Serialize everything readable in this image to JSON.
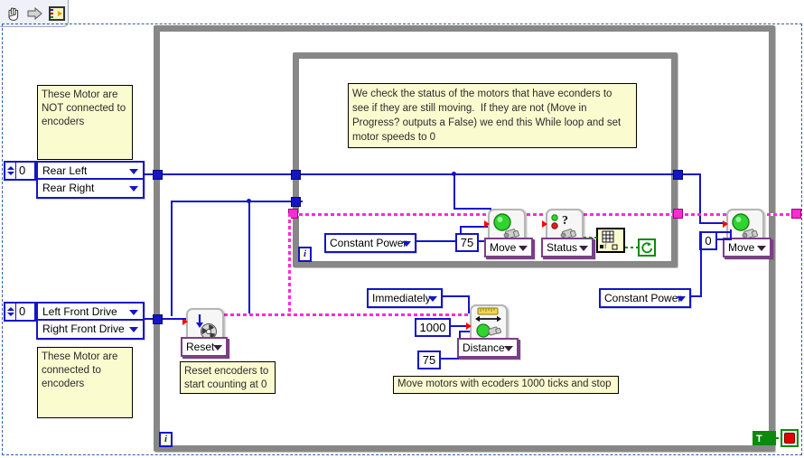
{
  "toolbar": {
    "icons": [
      {
        "name": "hand-tool-icon",
        "label": "Operate Value"
      },
      {
        "name": "arrow-tool-icon",
        "label": "Position/Size/Select"
      },
      {
        "name": "connector-pane-icon",
        "label": "Connector Pane"
      }
    ]
  },
  "comments": {
    "top_left": "These Motor are\nNOT connected to\nencoders",
    "status_note": "We check the status of the motors that have econders to\nsee if they are still moving.  If they are not (Move in\nProgress? outputs a False) we end this While loop and set\nmotor speeds to 0",
    "bottom_left": "These Motor are\nconnected to\nencoders",
    "reset_note": "Reset encoders to\nstart counting at 0",
    "encoder_move_note": "Move motors with ecoders 1000 ticks and stop"
  },
  "controls": {
    "rear_numeric": "0",
    "front_numeric": "0",
    "rear_motors": [
      "Rear Left",
      "Rear Right"
    ],
    "front_motors": [
      "Left Front Drive",
      "Right Front Drive"
    ]
  },
  "nodes": {
    "constant_power_inner": "Constant Power",
    "constant_power_outer": "Constant Power",
    "move_inner_selector": "Move",
    "move_inner_speed": "75",
    "status_selector": "Status",
    "move_outer_selector": "Move",
    "move_outer_speed": "0",
    "reset_selector": "Reset",
    "distance_selector": "Distance",
    "distance_mode": "Immediately",
    "distance_ticks": "1000",
    "distance_power": "75"
  },
  "loops": {
    "outer_iteration_label": "i",
    "inner_iteration_label": "i"
  },
  "terminals": {
    "true_constant": "T",
    "stop_button": "stop-button"
  },
  "colors": {
    "wire_numeric": "#1414c8",
    "wire_cluster": "#ff2ad4",
    "wire_boolean": "#0b8a0b",
    "structure_border": "#878787",
    "comment_bg": "#fbfbd0",
    "vi_selector_border": "#7a3f86"
  }
}
